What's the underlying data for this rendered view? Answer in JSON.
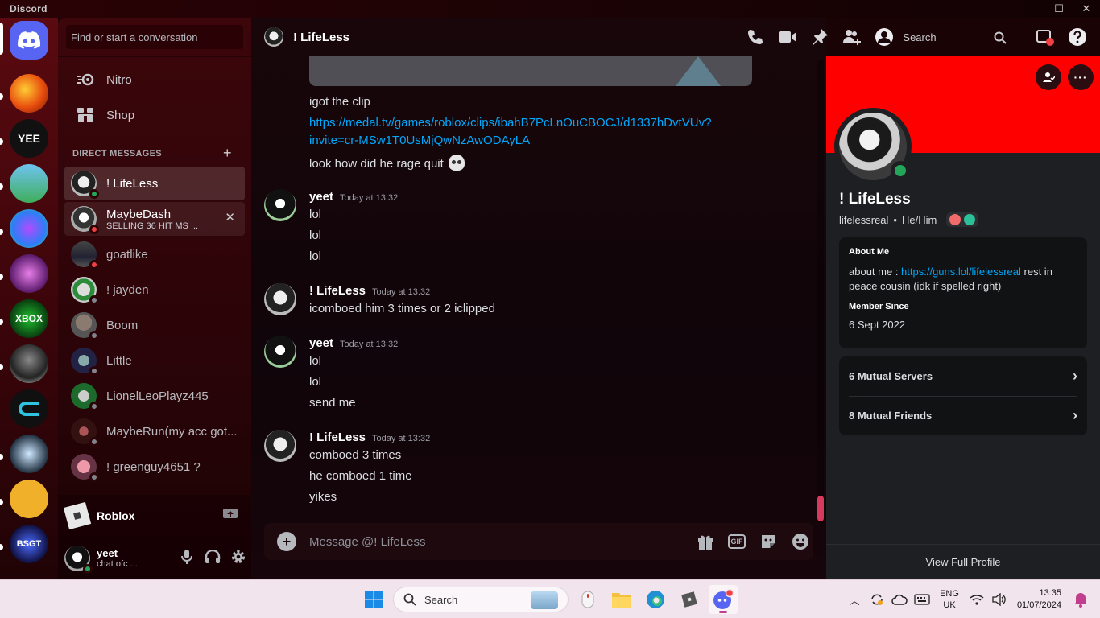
{
  "window": {
    "app_name": "Discord",
    "controls": [
      "—",
      "☐",
      "✕"
    ]
  },
  "search": {
    "placeholder": "Find or start a conversation"
  },
  "nav": {
    "nitro": "Nitro",
    "shop": "Shop"
  },
  "dm": {
    "header": "DIRECT MESSAGES",
    "add": "+",
    "items": [
      {
        "name": "! LifeLess",
        "sub": "",
        "status": "online"
      },
      {
        "name": "MaybeDash",
        "sub": "SELLING 36 HIT MS ...",
        "status": "dnd"
      },
      {
        "name": "goatlike",
        "sub": "",
        "status": "dnd"
      },
      {
        "name": "! jayden",
        "sub": "",
        "status": "offline"
      },
      {
        "name": "Boom",
        "sub": "",
        "status": "offline"
      },
      {
        "name": "Little",
        "sub": "",
        "status": "offline"
      },
      {
        "name": "LionelLeoPlayz445",
        "sub": "",
        "status": "offline"
      },
      {
        "name": "MaybeRun(my acc got...",
        "sub": "",
        "status": "offline"
      },
      {
        "name": "! greenguy4651 ?",
        "sub": "",
        "status": "offline"
      }
    ]
  },
  "activity": {
    "name": "Roblox"
  },
  "user": {
    "name": "yeet",
    "status": "chat ofc ..."
  },
  "chat": {
    "title": "! LifeLess",
    "header_search": "Search",
    "composer_placeholder": "Message @! LifeLess",
    "gif_label": "GIF",
    "messages": {
      "cont1": "igot the clip",
      "link_line1": "https://medal.tv/games/roblox/clips/ibahB7PcLnOuCBOCJ/d1337hDvtVUv?",
      "link_line2": "invite=cr-MSw1T0UsMjQwNzAwODAyLA",
      "cont2": "look how did he rage quit",
      "g1_author": "yeet",
      "g1_time": "Today at 13:32",
      "g1_lines": [
        "lol",
        "lol",
        "lol"
      ],
      "g2_author": "! LifeLess",
      "g2_time": "Today at 13:32",
      "g2_lines": [
        "icomboed him 3 times or 2 iclipped"
      ],
      "g3_author": "yeet",
      "g3_time": "Today at 13:32",
      "g3_lines": [
        "lol",
        "lol",
        "send me"
      ],
      "g4_author": "! LifeLess",
      "g4_time": "Today at 13:32",
      "g4_lines": [
        "comboed 3 times",
        "he comboed 1 time",
        "yikes"
      ]
    }
  },
  "profile": {
    "name": "! LifeLess",
    "username": "lifelessreal",
    "pronouns": "He/Him",
    "separator": "•",
    "about_heading": "About Me",
    "about_prefix": "about me : ",
    "about_link": "https://guns.lol/lifelessreal",
    "about_suffix": " rest in peace cousin (idk if spelled right)",
    "member_since_heading": "Member Since",
    "member_since": "6 Sept 2022",
    "mutual_servers": "6 Mutual Servers",
    "mutual_friends": "8 Mutual Friends",
    "footer": "View Full Profile",
    "banner_color": "#ff0000"
  },
  "taskbar": {
    "search": "Search",
    "lang_top": "ENG",
    "lang_bottom": "UK",
    "time": "13:35",
    "date": "01/07/2024"
  }
}
